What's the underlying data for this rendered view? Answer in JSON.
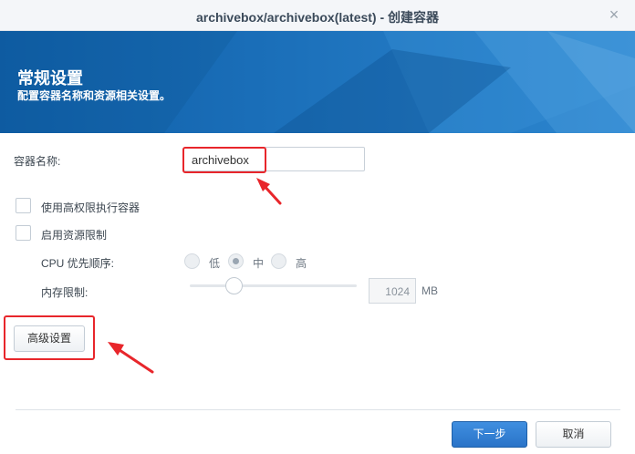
{
  "window": {
    "title": "archivebox/archivebox(latest) - 创建容器",
    "close_icon": "×"
  },
  "banner": {
    "title": "常规设置",
    "subtitle": "配置容器名称和资源相关设置。"
  },
  "form": {
    "container_name_label": "容器名称:",
    "container_name_value": "archivebox",
    "privileged_label": "使用高权限执行容器",
    "resource_limit_label": "启用资源限制",
    "cpu_priority_label": "CPU 优先顺序:",
    "cpu_options": [
      "低",
      "中",
      "高"
    ],
    "cpu_selected": "中",
    "memory_label": "内存限制:",
    "memory_value": "1024",
    "memory_unit": "MB",
    "memory_slider_fraction": 0.2
  },
  "buttons": {
    "advanced": "高级设置",
    "next": "下一步",
    "cancel": "取消"
  },
  "annotations": {
    "highlight_color": "#e8262b"
  },
  "colors": {
    "banner": "#1a6eb8",
    "primary_button": "#2a74c8"
  }
}
